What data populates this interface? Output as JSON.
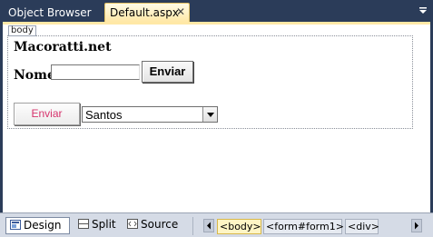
{
  "tabs": [
    {
      "label": "Object Browser",
      "active": false
    },
    {
      "label": "Default.aspx",
      "active": true
    }
  ],
  "tab_close_glyph": "✕",
  "designer": {
    "body_tag": "body",
    "title": "Macoratti.net",
    "nome_label": "Nome:",
    "nome_value": "",
    "enviar_button": "Enviar",
    "enviar_button2": "Enviar",
    "select_value": "Santos"
  },
  "view_buttons": [
    {
      "label": "Design",
      "icon": "design-icon",
      "active": true
    },
    {
      "label": "Split",
      "icon": "split-icon",
      "active": false
    },
    {
      "label": "Source",
      "icon": "source-icon",
      "active": false
    }
  ],
  "breadcrumbs": [
    "<body>",
    "<form#form1>",
    "<div>"
  ],
  "colors": {
    "tab_strip": "#2b3c59",
    "active_tab": "#ffe8a6",
    "enviar2_text": "#d6336c"
  }
}
